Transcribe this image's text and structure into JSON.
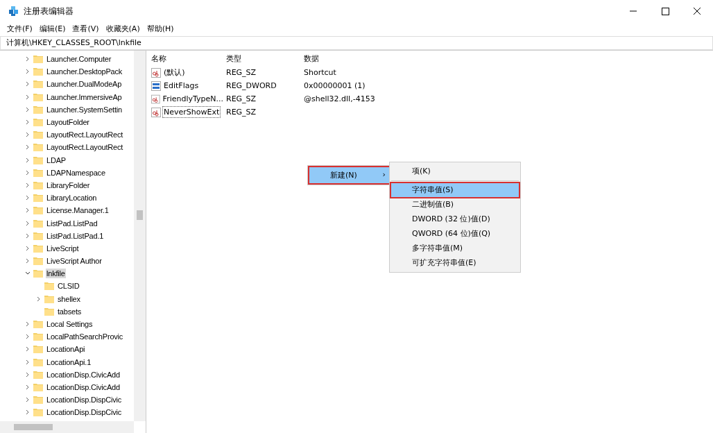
{
  "window": {
    "title": "注册表编辑器"
  },
  "menu": [
    "文件(F)",
    "编辑(E)",
    "查看(V)",
    "收藏夹(A)",
    "帮助(H)"
  ],
  "address": "计算机\\HKEY_CLASSES_ROOT\\lnkfile",
  "tree": [
    {
      "label": "Launcher.Computer",
      "expanded": false,
      "selected": false
    },
    {
      "label": "Launcher.DesktopPack",
      "expanded": false,
      "selected": false
    },
    {
      "label": "Launcher.DualModeAp",
      "expanded": false,
      "selected": false
    },
    {
      "label": "Launcher.ImmersiveAp",
      "expanded": false,
      "selected": false
    },
    {
      "label": "Launcher.SystemSettin",
      "expanded": false,
      "selected": false
    },
    {
      "label": "LayoutFolder",
      "expanded": false,
      "selected": false
    },
    {
      "label": "LayoutRect.LayoutRect",
      "expanded": false,
      "selected": false
    },
    {
      "label": "LayoutRect.LayoutRect",
      "expanded": false,
      "selected": false
    },
    {
      "label": "LDAP",
      "expanded": false,
      "selected": false
    },
    {
      "label": "LDAPNamespace",
      "expanded": false,
      "selected": false
    },
    {
      "label": "LibraryFolder",
      "expanded": false,
      "selected": false
    },
    {
      "label": "LibraryLocation",
      "expanded": false,
      "selected": false
    },
    {
      "label": "License.Manager.1",
      "expanded": false,
      "selected": false
    },
    {
      "label": "ListPad.ListPad",
      "expanded": false,
      "selected": false
    },
    {
      "label": "ListPad.ListPad.1",
      "expanded": false,
      "selected": false
    },
    {
      "label": "LiveScript",
      "expanded": false,
      "selected": false
    },
    {
      "label": "LiveScript Author",
      "expanded": false,
      "selected": false
    },
    {
      "label": "lnkfile",
      "expanded": true,
      "selected": true,
      "children": [
        {
          "label": "CLSID",
          "selected": false
        },
        {
          "label": "shellex",
          "expanded": false,
          "selected": false
        },
        {
          "label": "tabsets",
          "selected": false
        }
      ]
    },
    {
      "label": "Local Settings",
      "expanded": false,
      "selected": false
    },
    {
      "label": "LocalPathSearchProvic",
      "expanded": false,
      "selected": false
    },
    {
      "label": "LocationApi",
      "expanded": false,
      "selected": false
    },
    {
      "label": "LocationApi.1",
      "expanded": false,
      "selected": false
    },
    {
      "label": "LocationDisp.CivicAdd",
      "expanded": false,
      "selected": false
    },
    {
      "label": "LocationDisp.CivicAdd",
      "expanded": false,
      "selected": false
    },
    {
      "label": "LocationDisp.DispCivic",
      "expanded": false,
      "selected": false
    },
    {
      "label": "LocationDisp.DispCivic",
      "expanded": false,
      "selected": false
    }
  ],
  "columns": [
    "名称",
    "类型",
    "数据"
  ],
  "values": [
    {
      "kind": "string",
      "name": "(默认)",
      "type": "REG_SZ",
      "data": "Shortcut",
      "focused": false
    },
    {
      "kind": "binary",
      "name": "EditFlags",
      "type": "REG_DWORD",
      "data": "0x00000001 (1)",
      "focused": false
    },
    {
      "kind": "string",
      "name": "FriendlyTypeN...",
      "type": "REG_SZ",
      "data": "@shell32.dll,-4153",
      "focused": false
    },
    {
      "kind": "string",
      "name": "NeverShowExt",
      "type": "REG_SZ",
      "focused": true
    }
  ],
  "context_menu": {
    "label": "新建(N)",
    "arrow": "›",
    "submenu": [
      {
        "label": "项(K)",
        "selected": false,
        "separator_after": true
      },
      {
        "label": "字符串值(S)",
        "selected": true,
        "separator_after": false
      },
      {
        "label": "二进制值(B)",
        "selected": false,
        "separator_after": false
      },
      {
        "label": "DWORD (32 位)值(D)",
        "selected": false,
        "separator_after": false
      },
      {
        "label": "QWORD (64 位)值(Q)",
        "selected": false,
        "separator_after": false
      },
      {
        "label": "多字符串值(M)",
        "selected": false,
        "separator_after": false
      },
      {
        "label": "可扩充字符串值(E)",
        "selected": false,
        "separator_after": false
      }
    ]
  }
}
